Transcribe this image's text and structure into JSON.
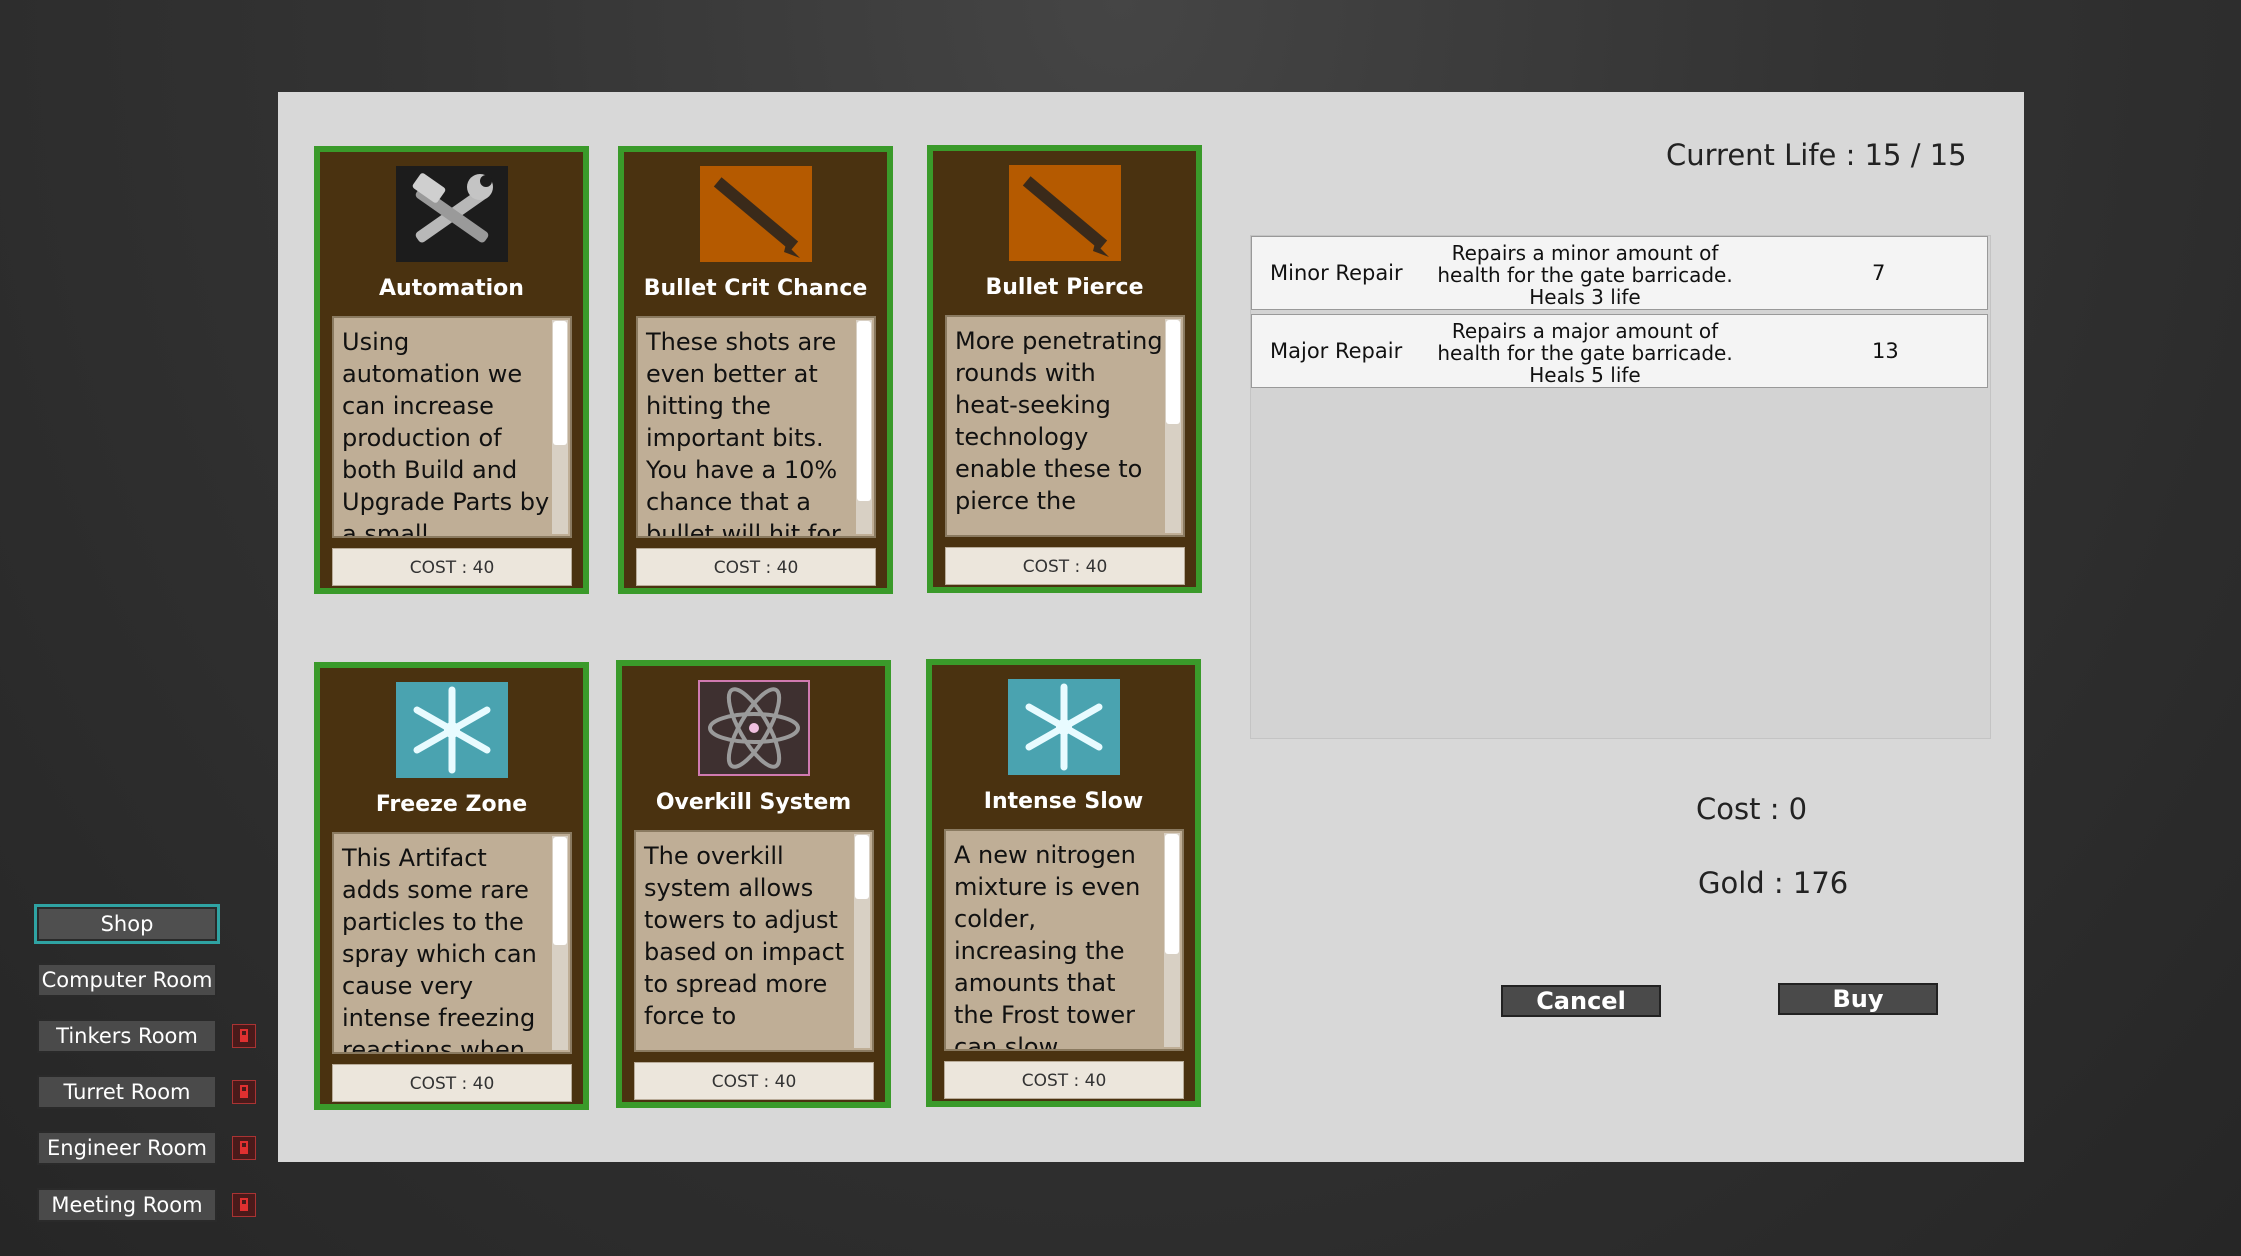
{
  "cards": [
    {
      "title": "Automation",
      "desc": "Using automation we can increase production of both Build and Upgrade Parts by a small",
      "cost": "COST : 40",
      "icon": "hammer-wrench-icon"
    },
    {
      "title": "Bullet Crit Chance",
      "desc": "These shots are even better at hitting the important bits. You have a 10% chance that a bullet will hit for",
      "cost": "COST : 40",
      "icon": "bullet-icon"
    },
    {
      "title": "Bullet Pierce",
      "desc": "More penetrating rounds with heat-seeking technology enable these to pierce the",
      "cost": "COST : 40",
      "icon": "bullet-icon"
    },
    {
      "title": "Freeze Zone",
      "desc": "This Artifact adds some rare particles to the spray which can cause very intense freezing reactions when",
      "cost": "COST : 40",
      "icon": "snowflake-icon"
    },
    {
      "title": "Overkill System",
      "desc": "The overkill system allows towers to adjust based on impact to spread more force to",
      "cost": "COST : 40",
      "icon": "atom-icon"
    },
    {
      "title": "Intense Slow",
      "desc": "A new nitrogen mixture is even colder, increasing the amounts that the Frost tower can slow",
      "cost": "COST : 40",
      "icon": "snowflake-icon"
    }
  ],
  "life": "Current Life : 15 / 15",
  "repairs": [
    {
      "name": "Minor Repair",
      "desc": "Repairs a minor amount of health for the gate barricade. Heals 3 life",
      "cost": "7"
    },
    {
      "name": "Major Repair",
      "desc": "Repairs a major amount of health for the gate barricade.  Heals 5 life",
      "cost": "13"
    }
  ],
  "cost": "Cost : 0",
  "gold": "Gold :  176",
  "buttons": {
    "cancel": "Cancel",
    "buy": "Buy"
  },
  "nav": [
    {
      "label": "Shop",
      "locked": false
    },
    {
      "label": "Computer Room",
      "locked": false
    },
    {
      "label": "Tinkers Room",
      "locked": true
    },
    {
      "label": "Turret Room",
      "locked": true
    },
    {
      "label": "Engineer Room",
      "locked": true
    },
    {
      "label": "Meeting Room",
      "locked": true
    }
  ],
  "colors": {
    "card_bg": "#4a3210",
    "card_border": "#3a9a2a",
    "panel": "#d8d8d8",
    "nav_active": "#2fa3a3"
  }
}
